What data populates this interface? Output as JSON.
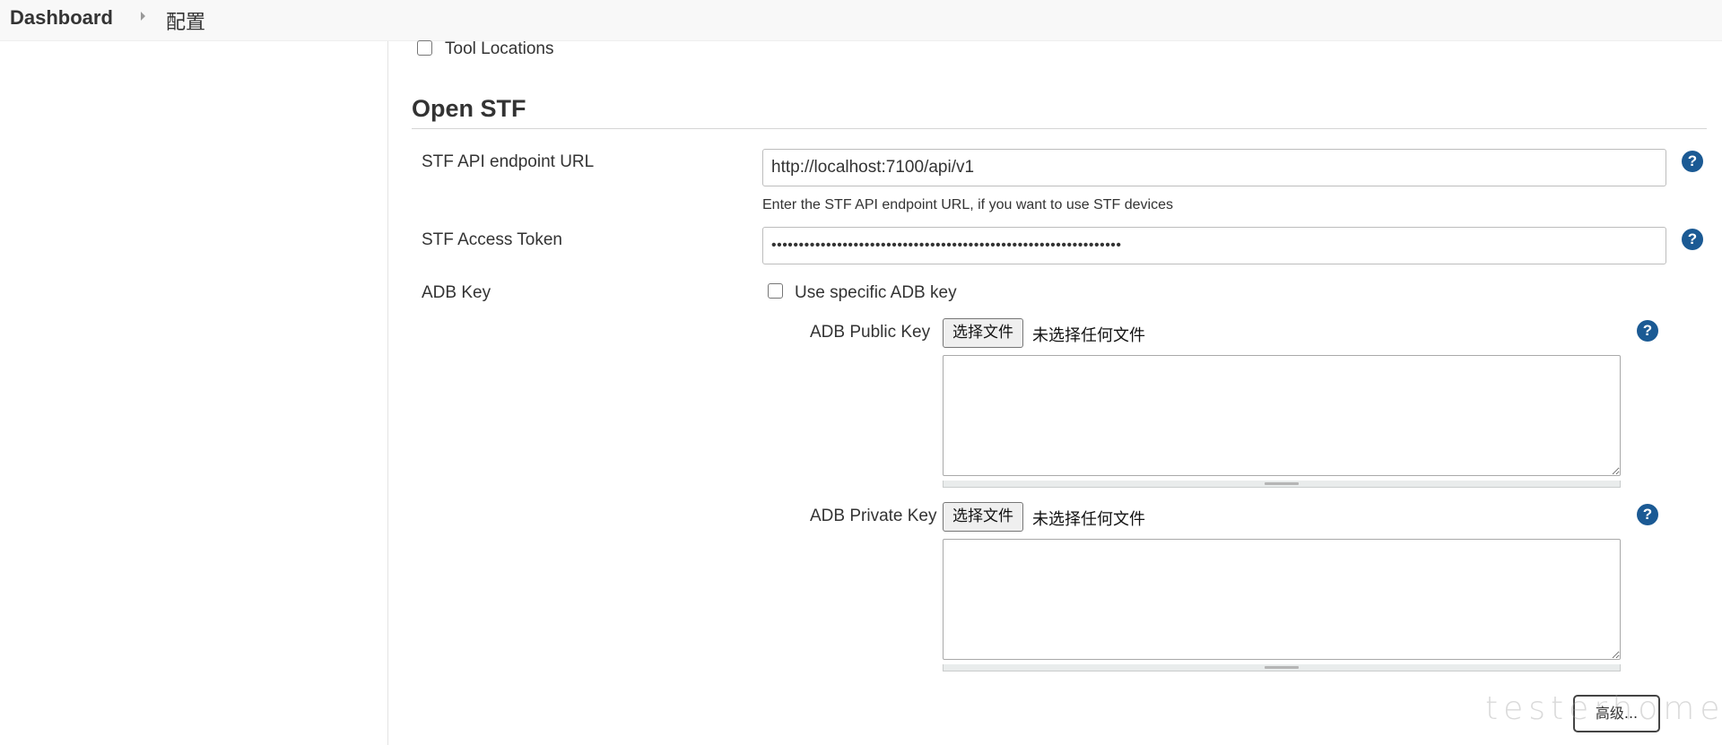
{
  "breadcrumb": {
    "dashboard": "Dashboard",
    "current": "配置"
  },
  "tool_locations": {
    "label": "Tool Locations",
    "checked": false
  },
  "section": {
    "title": "Open STF"
  },
  "stf_api_url": {
    "label": "STF API endpoint URL",
    "value": "http://localhost:7100/api/v1",
    "hint": "Enter the STF API endpoint URL, if you want to use STF devices",
    "help": "?"
  },
  "stf_access_token": {
    "label": "STF Access Token",
    "value": "••••••••••••••••••••••••••••••••••••••••••••••••••••••••••••••••",
    "help": "?"
  },
  "adb_key": {
    "label": "ADB Key",
    "use_specific_label": "Use specific ADB key",
    "checked": false,
    "public_key": {
      "label": "ADB Public Key",
      "button": "选择文件",
      "status": "未选择任何文件",
      "help": "?"
    },
    "private_key": {
      "label": "ADB Private Key",
      "button": "选择文件",
      "status": "未选择任何文件",
      "help": "?"
    }
  },
  "advanced_button": "高级...",
  "watermark": "testerhome.com",
  "colors": {
    "help_icon": "#1b5a94",
    "topbar_bg": "#f8f8f8"
  }
}
